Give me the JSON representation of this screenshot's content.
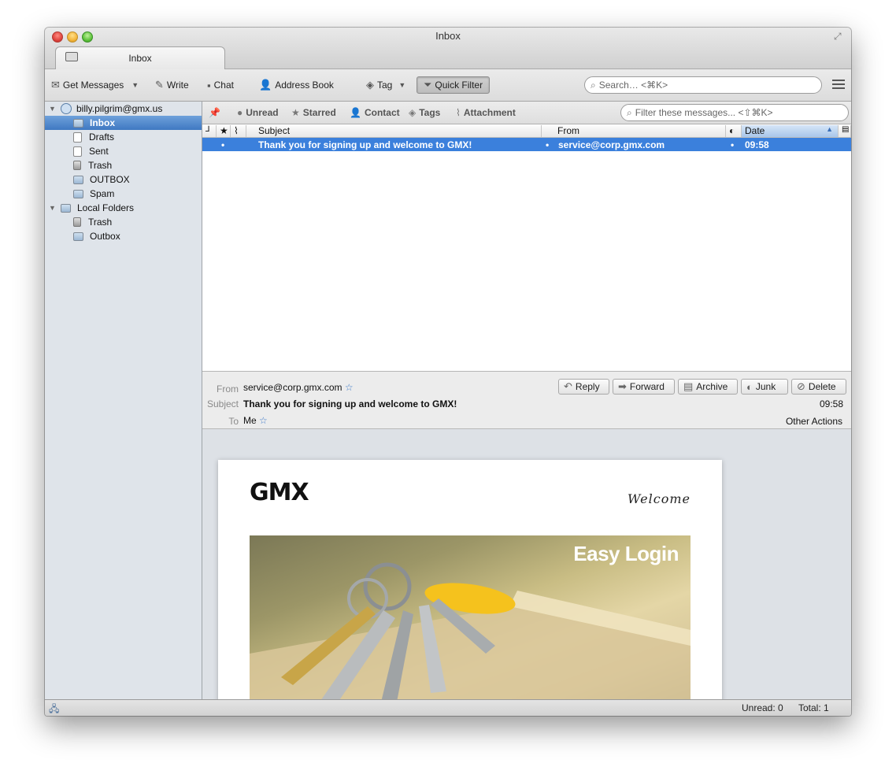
{
  "window": {
    "title": "Inbox"
  },
  "tab": {
    "label": "Inbox"
  },
  "toolbar": {
    "get_messages": "Get Messages",
    "write": "Write",
    "chat": "Chat",
    "address_book": "Address Book",
    "tag": "Tag",
    "quick_filter": "Quick Filter",
    "search_placeholder": "Search… <⌘K>"
  },
  "sidebar": {
    "account": "billy.pilgrim@gmx.us",
    "folders": [
      "Inbox",
      "Drafts",
      "Sent",
      "Trash",
      "OUTBOX",
      "Spam"
    ],
    "local_root": "Local Folders",
    "local_folders": [
      "Trash",
      "Outbox"
    ]
  },
  "quickfilter": {
    "unread": "Unread",
    "starred": "Starred",
    "contact": "Contact",
    "tags": "Tags",
    "attachment": "Attachment",
    "filter_placeholder": "Filter these messages... <⇧⌘K>"
  },
  "columns": {
    "subject": "Subject",
    "from": "From",
    "date": "Date"
  },
  "messages": [
    {
      "subject": "Thank you for signing up and welcome to GMX!",
      "from": "service@corp.gmx.com",
      "date": "09:58"
    }
  ],
  "header": {
    "from_label": "From",
    "from_value": "service@corp.gmx.com",
    "subject_label": "Subject",
    "subject_value": "Thank you for signing up and welcome to GMX!",
    "to_label": "To",
    "to_value": "Me",
    "time": "09:58",
    "other_actions": "Other Actions",
    "reply": "Reply",
    "forward": "Forward",
    "archive": "Archive",
    "junk": "Junk",
    "delete": "Delete"
  },
  "email_body": {
    "logo": "GMX",
    "welcome": "Welcome",
    "hero_title": "Easy Login"
  },
  "status": {
    "unread": "Unread: 0",
    "total": "Total: 1"
  }
}
